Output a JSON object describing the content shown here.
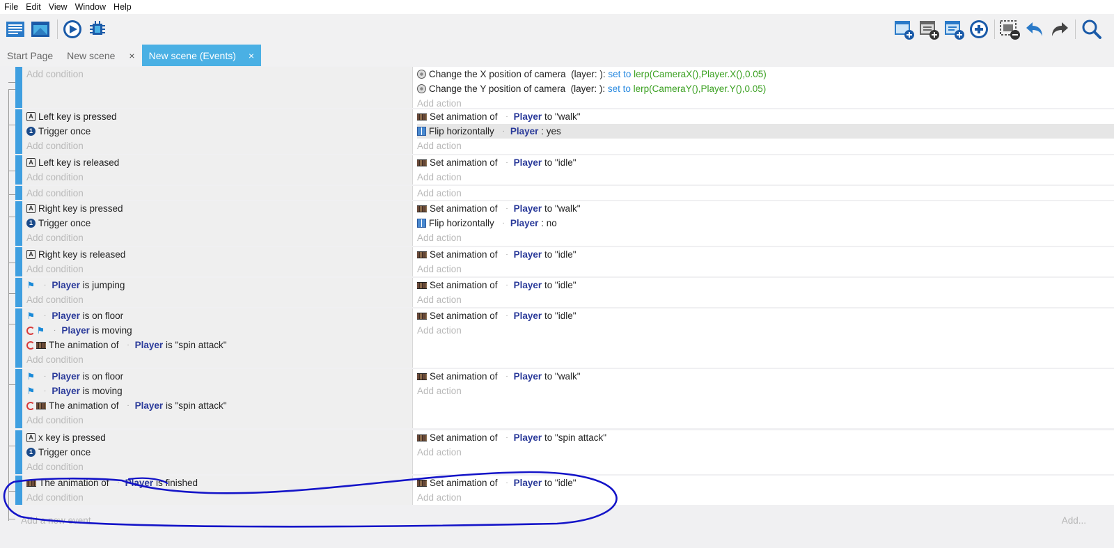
{
  "menu": [
    "File",
    "Edit",
    "View",
    "Window",
    "Help"
  ],
  "tabs": [
    {
      "label": "Start Page",
      "closable": false,
      "active": false
    },
    {
      "label": "New scene",
      "closable": true,
      "active": false
    },
    {
      "label": "New scene (Events)",
      "closable": true,
      "active": true
    }
  ],
  "close_glyph": "×",
  "add_condition": "Add condition",
  "add_action": "Add action",
  "add_new_event": "Add a new event",
  "add_short": "Add...",
  "events": [
    {
      "conditions": [],
      "actions": [
        {
          "icon": "camera-icon",
          "parts": [
            [
              "t",
              "Change the X position of camera  (layer: ): "
            ],
            [
              "op",
              "set to "
            ],
            [
              "expr",
              "lerp(CameraX(),Player.X(),0.05)"
            ]
          ]
        },
        {
          "icon": "camera-icon",
          "parts": [
            [
              "t",
              "Change the Y position of camera  (layer: ): "
            ],
            [
              "op",
              "set to "
            ],
            [
              "expr",
              "lerp(CameraY(),Player.Y(),0.05)"
            ]
          ]
        }
      ]
    },
    {
      "conditions": [
        {
          "icon": "keyboard-icon",
          "parts": [
            [
              "t",
              "Left key is pressed"
            ]
          ]
        },
        {
          "icon": "trigger-once-icon",
          "parts": [
            [
              "t",
              "Trigger once"
            ]
          ]
        }
      ],
      "actions": [
        {
          "icon": "animation-icon",
          "parts": [
            [
              "t",
              "Set animation of "
            ],
            [
              "dot",
              "·"
            ],
            [
              "obj",
              "Player"
            ],
            [
              "t",
              " to \"walk\""
            ]
          ]
        },
        {
          "icon": "flip-icon",
          "parts": [
            [
              "t",
              "Flip horizontally "
            ],
            [
              "dot",
              "·"
            ],
            [
              "obj",
              "Player"
            ],
            [
              "t",
              " : yes"
            ]
          ],
          "highlight": true
        }
      ]
    },
    {
      "conditions": [
        {
          "icon": "keyboard-icon",
          "parts": [
            [
              "t",
              "Left key is released"
            ]
          ]
        }
      ],
      "actions": [
        {
          "icon": "animation-icon",
          "parts": [
            [
              "t",
              "Set animation of "
            ],
            [
              "dot",
              "·"
            ],
            [
              "obj",
              "Player"
            ],
            [
              "t",
              " to \"idle\""
            ]
          ]
        }
      ]
    },
    {
      "conditions": [],
      "actions": []
    },
    {
      "conditions": [
        {
          "icon": "keyboard-icon",
          "parts": [
            [
              "t",
              "Right key is pressed"
            ]
          ]
        },
        {
          "icon": "trigger-once-icon",
          "parts": [
            [
              "t",
              "Trigger once"
            ]
          ]
        }
      ],
      "actions": [
        {
          "icon": "animation-icon",
          "parts": [
            [
              "t",
              "Set animation of "
            ],
            [
              "dot",
              "·"
            ],
            [
              "obj",
              "Player"
            ],
            [
              "t",
              " to \"walk\""
            ]
          ]
        },
        {
          "icon": "flip-icon",
          "parts": [
            [
              "t",
              "Flip horizontally "
            ],
            [
              "dot",
              "·"
            ],
            [
              "obj",
              "Player"
            ],
            [
              "t",
              " : no"
            ]
          ]
        }
      ]
    },
    {
      "conditions": [
        {
          "icon": "keyboard-icon",
          "parts": [
            [
              "t",
              "Right key is released"
            ]
          ]
        }
      ],
      "actions": [
        {
          "icon": "animation-icon",
          "parts": [
            [
              "t",
              "Set animation of "
            ],
            [
              "dot",
              "·"
            ],
            [
              "obj",
              "Player"
            ],
            [
              "t",
              " to \"idle\""
            ]
          ]
        }
      ]
    },
    {
      "conditions": [
        {
          "icon": "platformer-icon",
          "parts": [
            [
              "dot",
              "·"
            ],
            [
              "obj",
              "Player"
            ],
            [
              "t",
              " is jumping"
            ]
          ]
        }
      ],
      "actions": [
        {
          "icon": "animation-icon",
          "parts": [
            [
              "t",
              "Set animation of "
            ],
            [
              "dot",
              "·"
            ],
            [
              "obj",
              "Player"
            ],
            [
              "t",
              " to \"idle\""
            ]
          ]
        }
      ]
    },
    {
      "conditions": [
        {
          "icon": "platformer-icon",
          "parts": [
            [
              "dot",
              "·"
            ],
            [
              "obj",
              "Player"
            ],
            [
              "t",
              " is on floor"
            ]
          ]
        },
        {
          "icon": "platformer-icon",
          "invert": true,
          "parts": [
            [
              "dot",
              "·"
            ],
            [
              "obj",
              "Player"
            ],
            [
              "t",
              " is moving"
            ]
          ]
        },
        {
          "icon": "animation-icon",
          "invert": true,
          "parts": [
            [
              "t",
              "The animation of "
            ],
            [
              "dot",
              "·"
            ],
            [
              "obj",
              "Player"
            ],
            [
              "t",
              " is \"spin attack\""
            ]
          ]
        }
      ],
      "actions": [
        {
          "icon": "animation-icon",
          "parts": [
            [
              "t",
              "Set animation of "
            ],
            [
              "dot",
              "·"
            ],
            [
              "obj",
              "Player"
            ],
            [
              "t",
              " to \"idle\""
            ]
          ]
        }
      ]
    },
    {
      "conditions": [
        {
          "icon": "platformer-icon",
          "parts": [
            [
              "dot",
              "·"
            ],
            [
              "obj",
              "Player"
            ],
            [
              "t",
              " is on floor"
            ]
          ]
        },
        {
          "icon": "platformer-icon",
          "parts": [
            [
              "dot",
              "·"
            ],
            [
              "obj",
              "Player"
            ],
            [
              "t",
              " is moving"
            ]
          ]
        },
        {
          "icon": "animation-icon",
          "invert": true,
          "parts": [
            [
              "t",
              "The animation of "
            ],
            [
              "dot",
              "·"
            ],
            [
              "obj",
              "Player"
            ],
            [
              "t",
              " is \"spin attack\""
            ]
          ]
        }
      ],
      "actions": [
        {
          "icon": "animation-icon",
          "parts": [
            [
              "t",
              "Set animation of "
            ],
            [
              "dot",
              "·"
            ],
            [
              "obj",
              "Player"
            ],
            [
              "t",
              " to \"walk\""
            ]
          ]
        }
      ]
    },
    {
      "conditions": [
        {
          "icon": "keyboard-icon",
          "parts": [
            [
              "t",
              "x key is pressed"
            ]
          ]
        },
        {
          "icon": "trigger-once-icon",
          "parts": [
            [
              "t",
              "Trigger once"
            ]
          ]
        }
      ],
      "actions": [
        {
          "icon": "animation-icon",
          "parts": [
            [
              "t",
              "Set animation of "
            ],
            [
              "dot",
              "·"
            ],
            [
              "obj",
              "Player"
            ],
            [
              "t",
              " to \"spin attack\""
            ]
          ]
        }
      ]
    },
    {
      "conditions": [
        {
          "icon": "animation-icon",
          "parts": [
            [
              "t",
              "The animation of "
            ],
            [
              "dot",
              "·"
            ],
            [
              "obj",
              "Player"
            ],
            [
              "t",
              " is finished"
            ]
          ]
        }
      ],
      "actions": [
        {
          "icon": "animation-icon",
          "parts": [
            [
              "t",
              "Set animation of "
            ],
            [
              "dot",
              "·"
            ],
            [
              "obj",
              "Player"
            ],
            [
              "t",
              " to \"idle\""
            ]
          ]
        }
      ]
    }
  ]
}
